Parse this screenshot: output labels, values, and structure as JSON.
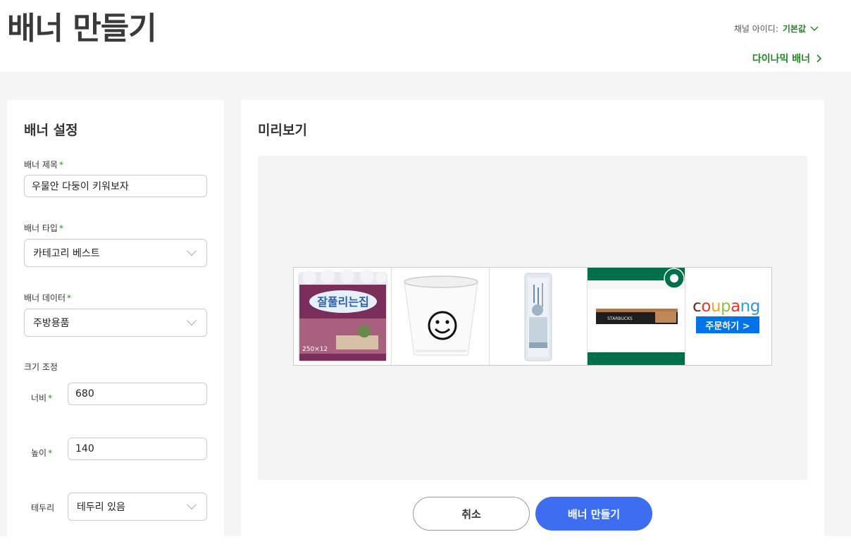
{
  "header": {
    "title": "배너 만들기",
    "channel_label": "채널 아이디:",
    "channel_value": "기본값",
    "dynamic_link": "다이나믹 배너"
  },
  "settings": {
    "title": "배너 설정",
    "banner_title_label": "배너 제목",
    "banner_title_value": "우물안 다둥이 키워보자",
    "banner_type_label": "배너 타입",
    "banner_type_value": "카테고리 베스트",
    "banner_data_label": "배너 데이터",
    "banner_data_value": "주방용품",
    "size_label": "크기 조정",
    "width_label": "너비",
    "width_value": "680",
    "height_label": "높이",
    "height_value": "140",
    "border_label": "테두리",
    "border_value": "테두리 있음",
    "required_mark": "*"
  },
  "preview": {
    "title": "미리보기",
    "products": [
      {
        "icon": "tissue-pack-icon",
        "text": "잘풀리는집",
        "sub": "250×12"
      },
      {
        "icon": "paper-cup-smiley-icon"
      },
      {
        "icon": "plastic-bag-roll-icon"
      },
      {
        "icon": "starbucks-capsule-icon",
        "text": "STARBUCKS"
      }
    ],
    "coupang_logo": "coupang",
    "order_button": "주문하기 >"
  },
  "actions": {
    "cancel": "취소",
    "create": "배너 만들기"
  },
  "colors": {
    "accent_green": "#1a8a1a",
    "primary_blue": "#3d6ef0",
    "coupang_blue": "#0073e9",
    "starbucks_green": "#00704a"
  }
}
